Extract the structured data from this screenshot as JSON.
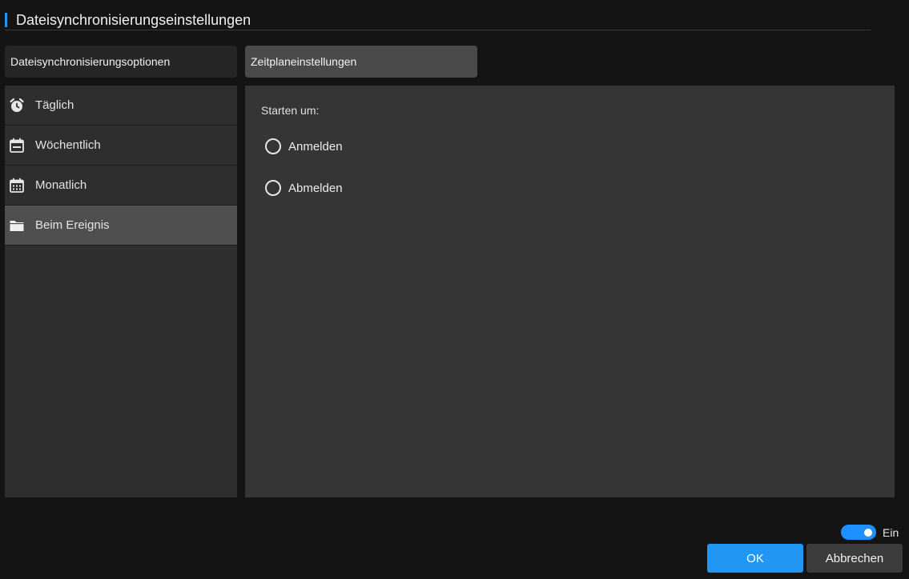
{
  "dialog": {
    "title": "Dateisynchronisierungseinstellungen"
  },
  "tabs": [
    {
      "label": "Dateisynchronisierungsoptionen",
      "active": false
    },
    {
      "label": "Zeitplaneinstellungen",
      "active": true
    }
  ],
  "sidebar": {
    "items": [
      {
        "label": "Täglich",
        "icon": "alarm-clock-icon",
        "active": false
      },
      {
        "label": "Wöchentlich",
        "icon": "calendar-week-icon",
        "active": false
      },
      {
        "label": "Monatlich",
        "icon": "calendar-month-icon",
        "active": false
      },
      {
        "label": "Beim Ereignis",
        "icon": "folder-icon",
        "active": true
      }
    ]
  },
  "panel": {
    "start_label": "Starten um:",
    "options": [
      {
        "label": "Anmelden",
        "selected": false
      },
      {
        "label": "Abmelden",
        "selected": false
      }
    ]
  },
  "footer": {
    "toggle_label": "Ein",
    "toggle_on": true,
    "ok_label": "OK",
    "cancel_label": "Abbrechen"
  },
  "colors": {
    "accent": "#2196f3",
    "background": "#141414",
    "panel": "#353535",
    "sidebar": "#2e2e2e",
    "active_item": "#4f4f4f"
  }
}
